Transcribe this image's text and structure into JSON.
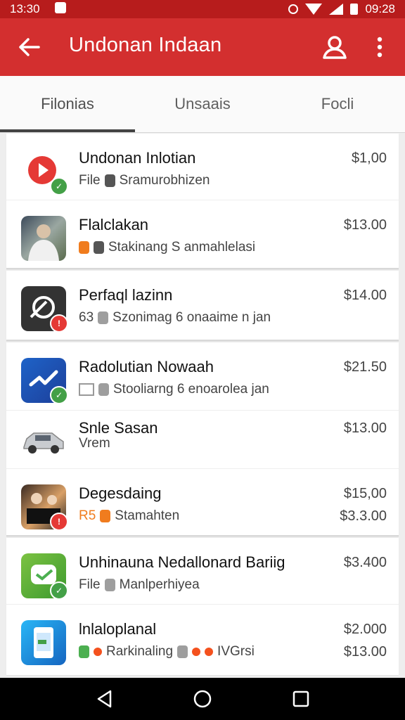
{
  "status_bar": {
    "time_left": "13:30",
    "time_right": "09:28"
  },
  "app_bar": {
    "title": "Undonan Indaan"
  },
  "tabs": [
    {
      "label": "Filonias",
      "active": true
    },
    {
      "label": "Unsaais",
      "active": false
    },
    {
      "label": "Focli",
      "active": false
    }
  ],
  "items": [
    {
      "name": "Undonan Inlotian",
      "sub": "Sramurobhizen",
      "sub_prefix": "File",
      "price": "$1,00"
    },
    {
      "name": "Flalclakan",
      "sub": "Stakinang S anmahlelasi",
      "price": "$13.00"
    },
    {
      "name": "Perfaql lazinn",
      "sub": "Szonimag 6 onaaime n jan",
      "sub_prefix": "63",
      "price": "$14.00"
    },
    {
      "name": "Radolutian Nowaah",
      "sub": "Stooliarng 6 enoarolea jan",
      "price": "$21.50"
    },
    {
      "name": "Snle Sasan",
      "sub": "Vrem",
      "price": "$13.00"
    },
    {
      "name": "Degesdaing",
      "sub": "Stamahten",
      "sub_prefix": "R5",
      "price": "$15,00",
      "price2": "$3.3.00"
    },
    {
      "name": "Unhinauna Nedallonard Bariig",
      "sub": "Manlperhiyea",
      "sub_prefix": "File",
      "price": "$3.400"
    },
    {
      "name": "lnlaloplanal",
      "sub": "Rarkinaling",
      "sub_suffix": "IVGrsi",
      "price": "$2.000",
      "price2": "$13.00"
    }
  ],
  "colors": {
    "app_bar": "#d32f2f",
    "status_bar": "#b71c1c",
    "tab_indicator": "#424242"
  }
}
